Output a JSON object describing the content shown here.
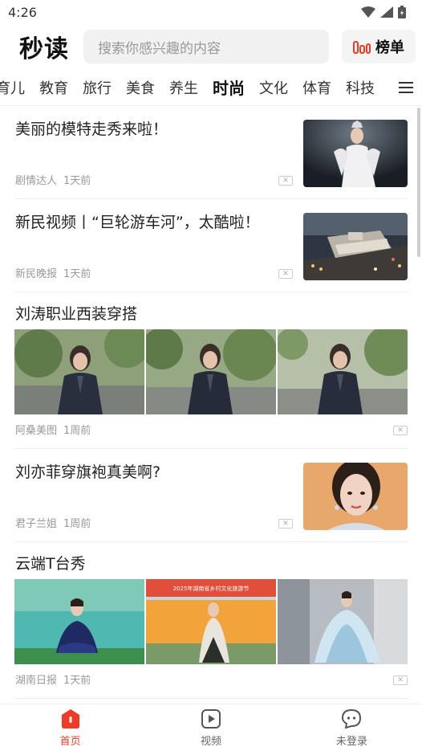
{
  "status": {
    "time": "4:26"
  },
  "header": {
    "logo_text": "秒读",
    "search_placeholder": "搜索你感兴趣的内容",
    "rank_label": "榜单"
  },
  "tabs": {
    "items": [
      "育儿",
      "教育",
      "旅行",
      "美食",
      "养生",
      "时尚",
      "文化",
      "体育",
      "科技"
    ],
    "active": "时尚"
  },
  "feed": {
    "items": [
      {
        "title": "美丽的模特走秀来啦！",
        "source": "剧情达人",
        "time": "1天前"
      },
      {
        "title": "新民视频丨“巨轮游车河”，太酷啦！",
        "source": "新民晚报",
        "time": "1天前"
      },
      {
        "title": "刘涛职业西装穿搭",
        "source": "阿桑美图",
        "time": "1周前"
      },
      {
        "title": "刘亦菲穿旗袍真美啊?",
        "source": "君子兰姐",
        "time": "1周前"
      },
      {
        "title": "云端T台秀",
        "source": "湖南日报",
        "time": "1天前",
        "image_banner_text": "2025年湖南省乡村文化旅游节"
      }
    ]
  },
  "bottom_nav": {
    "home": "首页",
    "video": "视频",
    "login": "未登录"
  },
  "colors": {
    "accent": "#ef3b24"
  }
}
